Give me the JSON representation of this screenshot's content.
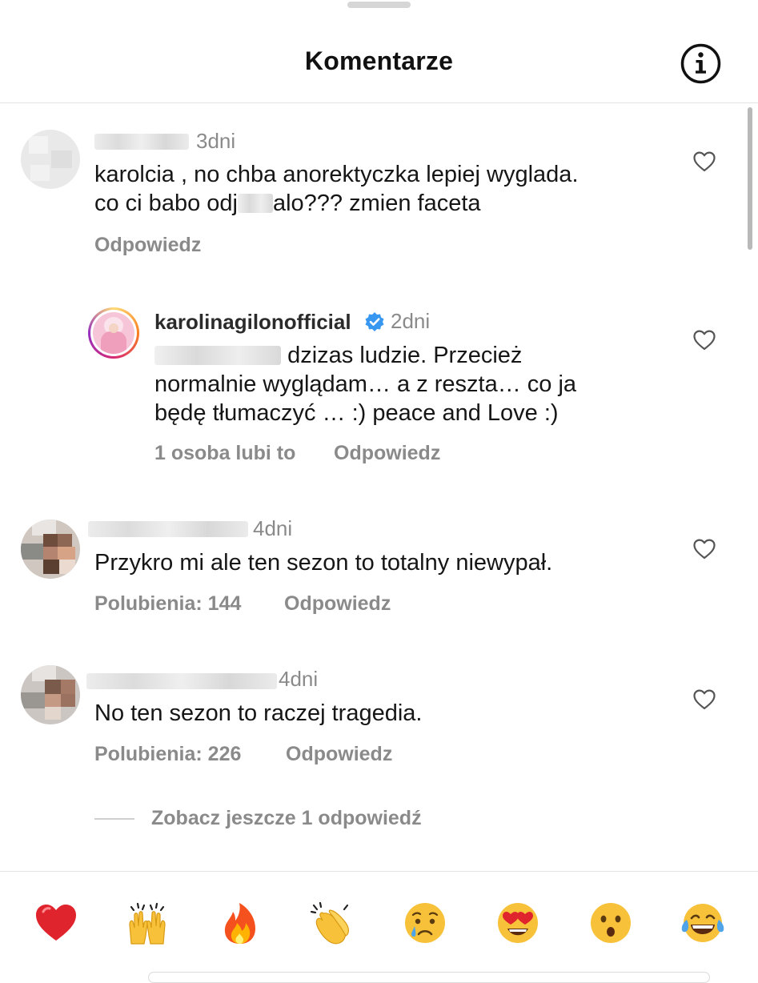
{
  "header": {
    "title": "Komentarze",
    "info_icon": "info-circle-icon"
  },
  "comments": [
    {
      "username_hidden": true,
      "time": "3dni",
      "text_line1": "karolcia , no chba anorektyczka lepiej wyglada.",
      "text_line2_start": "co ci babo odj",
      "text_line2_end": "alo??? zmien faceta",
      "actions": {
        "reply": "Odpowiedz"
      }
    },
    {
      "username": "karolinagilonofficial",
      "verified": true,
      "time": "2dni",
      "text_line1_end": "dzizas ludzie. Przecież",
      "text_line2": "normalnie wyglądam… a z reszta… co ja",
      "text_line3": "będę tłumaczyć … :) peace and Love :)",
      "actions": {
        "likes": "1 osoba lubi to",
        "reply": "Odpowiedz"
      }
    },
    {
      "username_hidden": true,
      "time": "4dni",
      "text": "Przykro mi ale ten sezon to totalny niewypał.",
      "actions": {
        "likes": "Polubienia: 144",
        "reply": "Odpowiedz"
      }
    },
    {
      "username_hidden": true,
      "time": "4dni",
      "text": "No ten sezon to raczej tragedia.",
      "actions": {
        "likes": "Polubienia: 226",
        "reply": "Odpowiedz"
      }
    }
  ],
  "view_more": "Zobacz jeszcze 1 odpowiedź",
  "emoji_reactions": [
    {
      "name": "red-heart",
      "glyph": "❤️"
    },
    {
      "name": "raising-hands",
      "glyph": "🙌"
    },
    {
      "name": "fire",
      "glyph": "🔥"
    },
    {
      "name": "clapping-hands",
      "glyph": "👏"
    },
    {
      "name": "crying-face",
      "glyph": "😢"
    },
    {
      "name": "heart-eyes",
      "glyph": "😍"
    },
    {
      "name": "surprised-face",
      "glyph": "😮"
    },
    {
      "name": "tears-of-joy",
      "glyph": "😂"
    }
  ],
  "colors": {
    "verified": "#3897f0",
    "secondary_text": "#8a8a8a",
    "story_ring": "#d62976"
  }
}
